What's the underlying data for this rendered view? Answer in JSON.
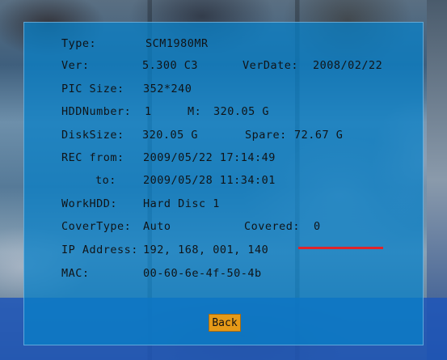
{
  "info": {
    "type_label": "Type:",
    "type_value": "SCM1980MR",
    "ver_label": "Ver:",
    "ver_value": "5.300 C3",
    "verdate_label": "VerDate:",
    "verdate_value": "2008/02/22",
    "pic_label": "PIC Size:",
    "pic_value": "352*240",
    "hddnum_label": "HDDNumber:",
    "hddnum_value": "1",
    "m_label": "M:",
    "m_value": "320.05 G",
    "disk_label": "DiskSize:",
    "disk_value": "320.05 G",
    "spare_label": "Spare:",
    "spare_value": "72.67  G",
    "rec_from_label": "REC from:",
    "rec_from_value": "2009/05/22 17:14:49",
    "rec_to_label": "to:",
    "rec_to_value": "2009/05/28 11:34:01",
    "workhdd_label": "WorkHDD:",
    "workhdd_value": "Hard Disc 1",
    "cover_label": "CoverType:",
    "cover_value": "Auto",
    "covered_label": "Covered:",
    "covered_value": "0",
    "ip_label": "IP Address:",
    "ip_value": "192, 168,  001, 140",
    "mac_label": "MAC:",
    "mac_value": "00-60-6e-4f-50-4b"
  },
  "back_label": "Back",
  "colors": {
    "panel": "#0880c8",
    "highlight_line": "#e0242a",
    "back_button": "#e59a18"
  }
}
